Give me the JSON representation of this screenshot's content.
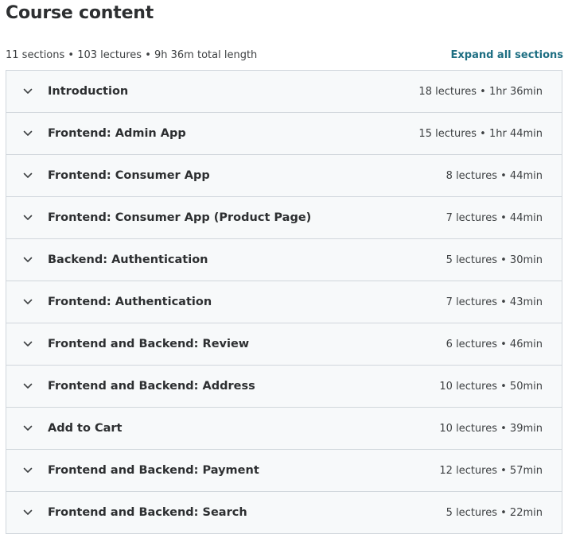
{
  "header": {
    "title": "Course content",
    "summary": "11 sections • 103 lectures • 9h 36m total length",
    "expand_all_label": "Expand all sections"
  },
  "colors": {
    "text": "#2d2f31",
    "link": "#1d6e82",
    "row_background": "#f7f9fa",
    "border": "#d1d7dc"
  },
  "sections": [
    {
      "title": "Introduction",
      "meta": "18 lectures • 1hr 36min"
    },
    {
      "title": "Frontend: Admin App",
      "meta": "15 lectures • 1hr 44min"
    },
    {
      "title": "Frontend: Consumer App",
      "meta": "8 lectures • 44min"
    },
    {
      "title": "Frontend: Consumer App (Product Page)",
      "meta": "7 lectures • 44min"
    },
    {
      "title": "Backend: Authentication",
      "meta": "5 lectures • 30min"
    },
    {
      "title": "Frontend: Authentication",
      "meta": "7 lectures • 43min"
    },
    {
      "title": "Frontend and Backend: Review",
      "meta": "6 lectures • 46min"
    },
    {
      "title": "Frontend and Backend: Address",
      "meta": "10 lectures • 50min"
    },
    {
      "title": "Add to Cart",
      "meta": "10 lectures • 39min"
    },
    {
      "title": "Frontend and Backend: Payment",
      "meta": "12 lectures • 57min"
    },
    {
      "title": "Frontend and Backend: Search",
      "meta": "5 lectures • 22min"
    }
  ],
  "icons": {
    "section_toggle": "chevron-down-icon"
  }
}
